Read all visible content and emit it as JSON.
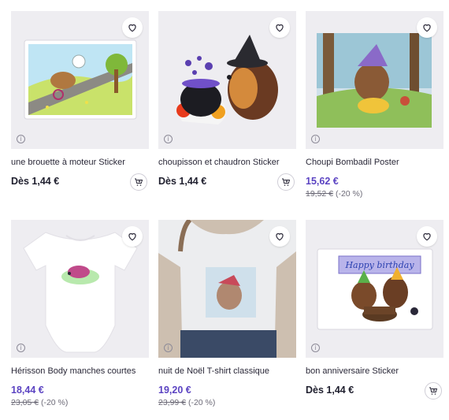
{
  "products": [
    {
      "title": "une brouette à moteur Sticker",
      "price": "Dès 1,44 €",
      "old_price": "",
      "discount": ""
    },
    {
      "title": "choupisson et chaudron Sticker",
      "price": "Dès 1,44 €",
      "old_price": "",
      "discount": ""
    },
    {
      "title": "Choupi Bombadil Poster",
      "price": "15,62 €",
      "old_price": "19,52 €",
      "discount": "(-20 %)"
    },
    {
      "title": "Hérisson Body manches courtes",
      "price": "18,44 €",
      "old_price": "23,05 €",
      "discount": "(-20 %)"
    },
    {
      "title": "nuit de Noël T-shirt classique",
      "price": "19,20 €",
      "old_price": "23,99 €",
      "discount": "(-20 %)"
    },
    {
      "title": "bon anniversaire Sticker",
      "price": "Dès 1,44 €",
      "old_price": "",
      "discount": ""
    }
  ],
  "sticker_text": "Happy birthday",
  "icons": {
    "favorite": "heart-icon",
    "info": "info-icon",
    "cart": "add-to-cart-icon"
  },
  "colors": {
    "sale_price": "#5b43c2",
    "tile_background": "#eeedf1"
  }
}
